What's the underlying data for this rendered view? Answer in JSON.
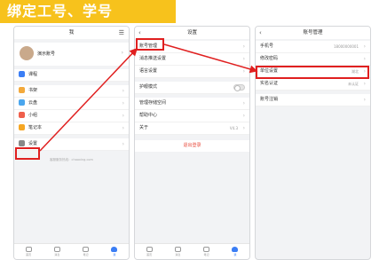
{
  "banner_title": "绑定工号、学号",
  "screen1": {
    "nav_title": "我",
    "profile_name": "演示账号",
    "items": [
      {
        "label": "课程",
        "color": "#3b7ef5"
      },
      {
        "label": "书架",
        "color": "#f3a93b"
      },
      {
        "label": "云盘",
        "color": "#4aa6ee"
      },
      {
        "label": "小组",
        "color": "#ef5f4c"
      },
      {
        "label": "笔记本",
        "color": "#f5a623"
      },
      {
        "label": "设置",
        "color": "#888888"
      }
    ],
    "footer": "客服服务热线：chaoxing.com",
    "tabs": [
      "首页",
      "消息",
      "笔记",
      "我"
    ]
  },
  "screen2": {
    "nav_title": "设置",
    "items": [
      {
        "label": "账号管理"
      },
      {
        "label": "消息推送设置"
      },
      {
        "label": "语言设置"
      },
      {
        "label": "护眼模式",
        "toggle": true
      },
      {
        "label": "管理存储空间"
      },
      {
        "label": "帮助中心"
      },
      {
        "label": "关于",
        "value": "V4.3"
      }
    ],
    "logout": "退出登录",
    "tabs": [
      "首页",
      "消息",
      "笔记",
      "我"
    ]
  },
  "screen3": {
    "nav_title": "账号管理",
    "items": [
      {
        "label": "手机号",
        "value": "18000000001"
      },
      {
        "label": "修改密码"
      },
      {
        "label": "单位设置",
        "value": "湖北"
      },
      {
        "label": "实名认证",
        "value": "未认证"
      },
      {
        "label": "账号注销"
      }
    ]
  }
}
